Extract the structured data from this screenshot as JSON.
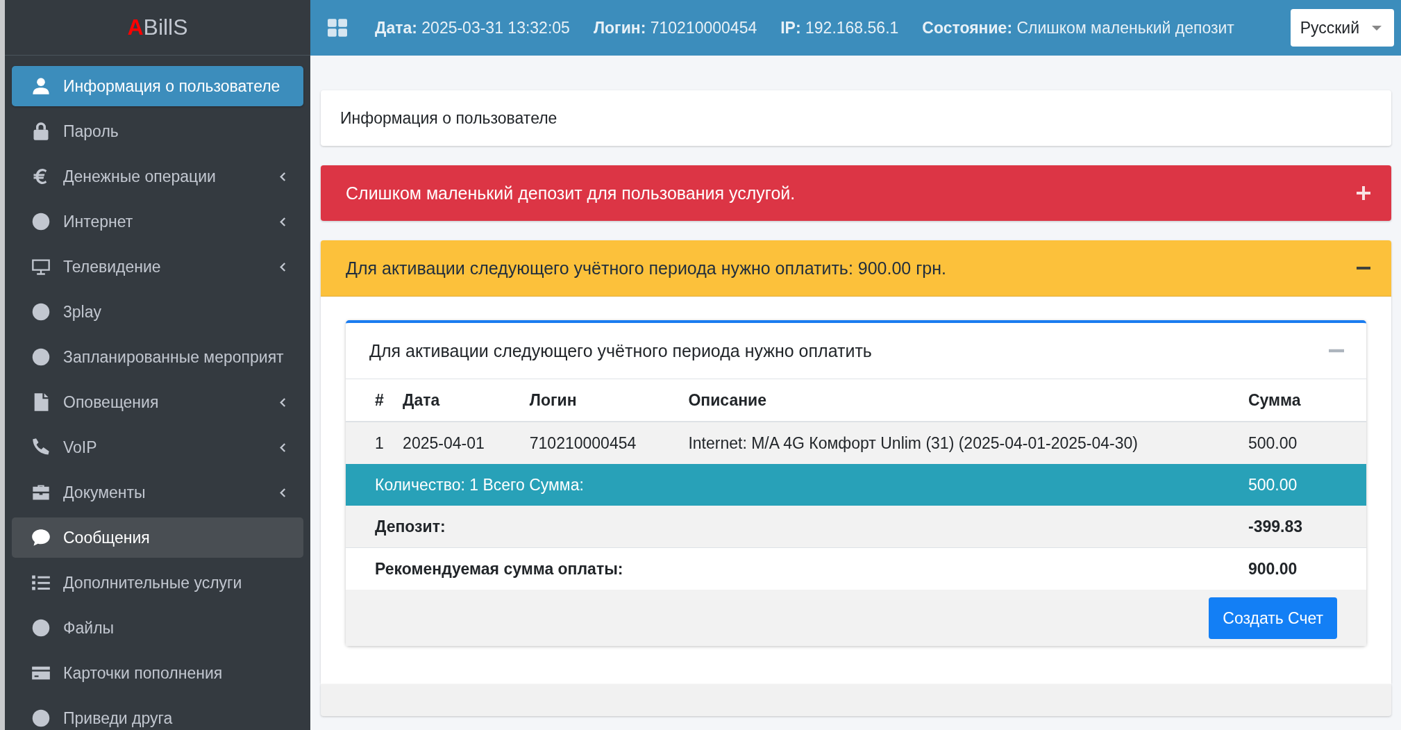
{
  "sidebar": {
    "logo": {
      "accent": "A",
      "rest": "BillS"
    },
    "items": [
      {
        "label": "Информация о пользователе",
        "kind": "user",
        "selected": true,
        "hovered": false,
        "expandable": false
      },
      {
        "label": "Пароль",
        "kind": "lock",
        "selected": false,
        "hovered": false,
        "expandable": false
      },
      {
        "label": "Денежные операции",
        "kind": "euro",
        "selected": false,
        "hovered": false,
        "expandable": true
      },
      {
        "label": "Интернет",
        "kind": "circle",
        "selected": false,
        "hovered": false,
        "expandable": true
      },
      {
        "label": "Телевидение",
        "kind": "monitor",
        "selected": false,
        "hovered": false,
        "expandable": true
      },
      {
        "label": "3play",
        "kind": "circle",
        "selected": false,
        "hovered": false,
        "expandable": false
      },
      {
        "label": "Запланированные мероприят",
        "kind": "circle",
        "selected": false,
        "hovered": false,
        "expandable": false
      },
      {
        "label": "Оповещения",
        "kind": "file",
        "selected": false,
        "hovered": false,
        "expandable": true
      },
      {
        "label": "VoIP",
        "kind": "phone",
        "selected": false,
        "hovered": false,
        "expandable": true
      },
      {
        "label": "Документы",
        "kind": "briefcase",
        "selected": false,
        "hovered": false,
        "expandable": true
      },
      {
        "label": "Сообщения",
        "kind": "comment",
        "selected": false,
        "hovered": true,
        "expandable": false
      },
      {
        "label": "Дополнительные услуги",
        "kind": "list",
        "selected": false,
        "hovered": false,
        "expandable": false
      },
      {
        "label": "Файлы",
        "kind": "circle",
        "selected": false,
        "hovered": false,
        "expandable": false
      },
      {
        "label": "Карточки пополнения",
        "kind": "card",
        "selected": false,
        "hovered": false,
        "expandable": false
      },
      {
        "label": "Приведи друга",
        "kind": "circle",
        "selected": false,
        "hovered": false,
        "expandable": false
      }
    ]
  },
  "header": {
    "fields": [
      {
        "label": "Дата:",
        "value": "2025-03-31 13:32:05"
      },
      {
        "label": "Логин:",
        "value": "710210000454"
      },
      {
        "label": "IP:",
        "value": "192.168.56.1"
      },
      {
        "label": "Состояние:",
        "value": "Слишком маленький депозит"
      }
    ],
    "language": "Русский"
  },
  "page_title": "Информация о пользователе",
  "alerts": [
    {
      "text": "Слишком маленький депозит для пользования услугой.",
      "kind": "danger",
      "expanded": false
    },
    {
      "text": "Для активации следующего учётного периода нужно оплатить: 900.00 грн.",
      "kind": "warning",
      "expanded": true
    }
  ],
  "invoice_card": {
    "title": "Для активации следующего учётного периода нужно оплатить",
    "expanded": true,
    "columns": [
      "#",
      "Дата",
      "Логин",
      "Описание",
      "Сумма"
    ],
    "rows": [
      [
        "1",
        "2025-04-01",
        "710210000454",
        "Internet: M/A 4G Комфорт Unlim (31) (2025-04-01-2025-04-30)",
        "500.00"
      ]
    ],
    "total": {
      "label": "Количество: 1 Всего Сумма:",
      "value": "500.00"
    },
    "deposit": {
      "label": "Депозит:",
      "value": "-399.83"
    },
    "recommended": {
      "label": "Рекомендуемая сумма оплаты:",
      "value": "900.00"
    },
    "button": "Создать Счет"
  }
}
